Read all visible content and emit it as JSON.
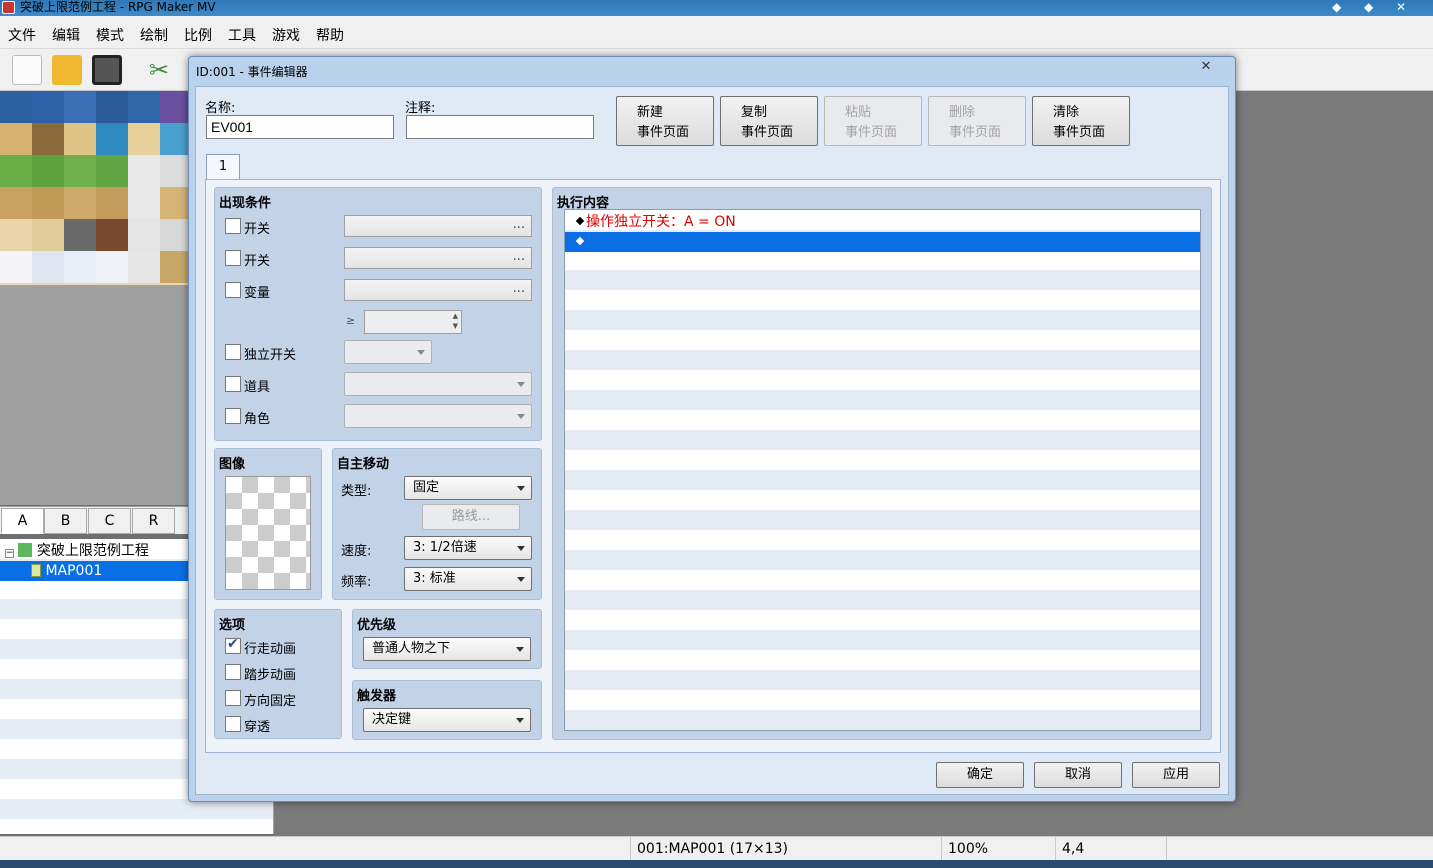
{
  "window": {
    "title": "突破上限范例工程 - RPG Maker MV"
  },
  "menu": [
    "文件",
    "编辑",
    "模式",
    "绘制",
    "比例",
    "工具",
    "游戏",
    "帮助"
  ],
  "toolbar": {
    "icons": [
      "new-project-icon",
      "open-project-icon",
      "save-project-icon",
      "cut-icon",
      "layer-icon",
      "event-icon",
      "pencil-icon",
      "rectangle-icon",
      "ellipse-icon",
      "fill-icon",
      "shadow-pen-icon",
      "zoom-in-icon",
      "zoom-out-icon",
      "zoom-actual-icon",
      "database-icon",
      "plugin-manager-icon",
      "sound-test-icon",
      "event-searcher-icon",
      "resource-manager-icon",
      "character-generator-icon",
      "playtest-icon"
    ]
  },
  "tileset_tabs": [
    "A",
    "B",
    "C",
    "R"
  ],
  "map_tree": {
    "project": "突破上限范例工程",
    "map": "MAP001"
  },
  "status": {
    "map": "001:MAP001 (17×13)",
    "zoom": "100%",
    "coords": "4,4"
  },
  "dialog": {
    "title": "ID:001 - 事件编辑器",
    "name_label": "名称:",
    "name_value": "EV001",
    "note_label": "注释:",
    "note_value": "",
    "buttons": {
      "new": [
        "新建",
        "事件页面"
      ],
      "copy": [
        "复制",
        "事件页面"
      ],
      "paste": [
        "粘贴",
        "事件页面"
      ],
      "delete": [
        "删除",
        "事件页面"
      ],
      "clear": [
        "清除",
        "事件页面"
      ]
    },
    "page_tab": "1",
    "conditions": {
      "title": "出现条件",
      "switch1": "开关",
      "switch2": "开关",
      "variable": "变量",
      "ge": "≥",
      "self_switch": "独立开关",
      "item": "道具",
      "actor": "角色",
      "dots": "..."
    },
    "image": {
      "title": "图像"
    },
    "autonomous": {
      "title": "自主移动",
      "type_label": "类型:",
      "type_value": "固定",
      "route_button": "路线...",
      "speed_label": "速度:",
      "speed_value": "3: 1/2倍速",
      "freq_label": "频率:",
      "freq_value": "3: 标准"
    },
    "options": {
      "title": "选项",
      "walking": "行走动画",
      "stepping": "踏步动画",
      "direction_fix": "方向固定",
      "through": "穿透",
      "walking_checked": true
    },
    "priority": {
      "title": "优先级",
      "value": "普通人物之下"
    },
    "trigger": {
      "title": "触发器",
      "value": "决定键"
    },
    "contents": {
      "title": "执行内容",
      "commands": [
        "操作独立开关：A = ON",
        ""
      ],
      "command_color": "#e00000"
    },
    "footer": {
      "ok": "确定",
      "cancel": "取消",
      "apply": "应用"
    },
    "close": "✕"
  }
}
